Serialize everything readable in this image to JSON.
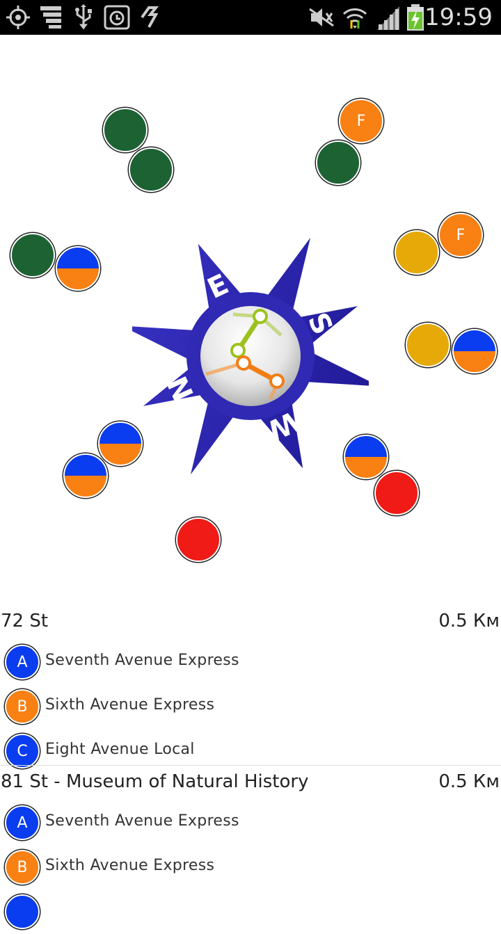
{
  "status_bar": {
    "time": "19:59",
    "left_icons": [
      "gps-icon",
      "stack-icon",
      "usb-icon",
      "alarm-icon",
      "sync-icon"
    ],
    "right_icons": [
      "mute-icon",
      "wifi-icon",
      "signal-icon",
      "battery-charging-icon"
    ]
  },
  "radar": {
    "compass_letters": {
      "e": "E",
      "s": "S",
      "w": "W",
      "n": "N"
    },
    "markers": [
      {
        "id": "m1",
        "type": "solid",
        "color": "#1d6233",
        "label": ""
      },
      {
        "id": "m2",
        "type": "solid",
        "color": "#1d6233",
        "label": ""
      },
      {
        "id": "m3",
        "type": "solid",
        "color": "#f98012",
        "label": "F"
      },
      {
        "id": "m4",
        "type": "solid",
        "color": "#1d6233",
        "label": ""
      },
      {
        "id": "m5",
        "type": "solid",
        "color": "#1d6233",
        "label": ""
      },
      {
        "id": "m6",
        "type": "half",
        "color_top": "#0a3cf0",
        "color_bottom": "#f98012",
        "label": ""
      },
      {
        "id": "m7",
        "type": "solid",
        "color": "#f98012",
        "label": "F"
      },
      {
        "id": "m8",
        "type": "solid",
        "color": "#e6a908",
        "label": ""
      },
      {
        "id": "m9",
        "type": "solid",
        "color": "#e6a908",
        "label": ""
      },
      {
        "id": "m10",
        "type": "half",
        "color_top": "#0a3cf0",
        "color_bottom": "#f98012",
        "label": ""
      },
      {
        "id": "m11",
        "type": "half",
        "color_top": "#0a3cf0",
        "color_bottom": "#f98012",
        "label": ""
      },
      {
        "id": "m12",
        "type": "half",
        "color_top": "#0a3cf0",
        "color_bottom": "#f98012",
        "label": ""
      },
      {
        "id": "m13",
        "type": "half",
        "color_top": "#0a3cf0",
        "color_bottom": "#f98012",
        "label": ""
      },
      {
        "id": "m14",
        "type": "solid",
        "color": "#f01a16",
        "label": ""
      },
      {
        "id": "m15",
        "type": "solid",
        "color": "#f01a16",
        "label": ""
      }
    ]
  },
  "stations": [
    {
      "name": "72 St",
      "distance": "0.5 Км",
      "lines": [
        {
          "badge": "A",
          "name": "Seventh Avenue Express",
          "color": "#0a3cf0"
        },
        {
          "badge": "B",
          "name": "Sixth Avenue Express",
          "color": "#f98012"
        },
        {
          "badge": "C",
          "name": "Eight Avenue Local",
          "color": "#0a3cf0"
        }
      ]
    },
    {
      "name": "81 St - Museum of Natural History",
      "distance": "0.5 Км",
      "lines": [
        {
          "badge": "A",
          "name": "Seventh Avenue Express",
          "color": "#0a3cf0"
        },
        {
          "badge": "B",
          "name": "Sixth Avenue Express",
          "color": "#f98012"
        },
        {
          "badge": "",
          "name": "",
          "color": "#0a3cf0"
        }
      ]
    }
  ]
}
